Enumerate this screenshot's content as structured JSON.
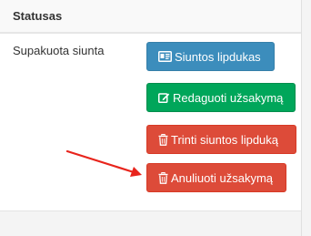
{
  "table": {
    "header": "Statusas",
    "status_value": "Supakuota siunta"
  },
  "actions": {
    "label_button": "Siuntos lipdukas",
    "edit_button": "Redaguoti užsakymą",
    "delete_label_button": "Trinti siuntos lipduką",
    "cancel_order_button": "Anuliuoti užsakymą"
  },
  "icons": {
    "label_button": "id-card-icon",
    "edit_button": "edit-icon",
    "delete_label_button": "trash-icon",
    "cancel_order_button": "trash-icon",
    "annotation": "red-arrow"
  },
  "colors": {
    "info": "#3c8dbc",
    "success": "#00a65a",
    "danger": "#dd4b39",
    "arrow": "#e8241c"
  }
}
